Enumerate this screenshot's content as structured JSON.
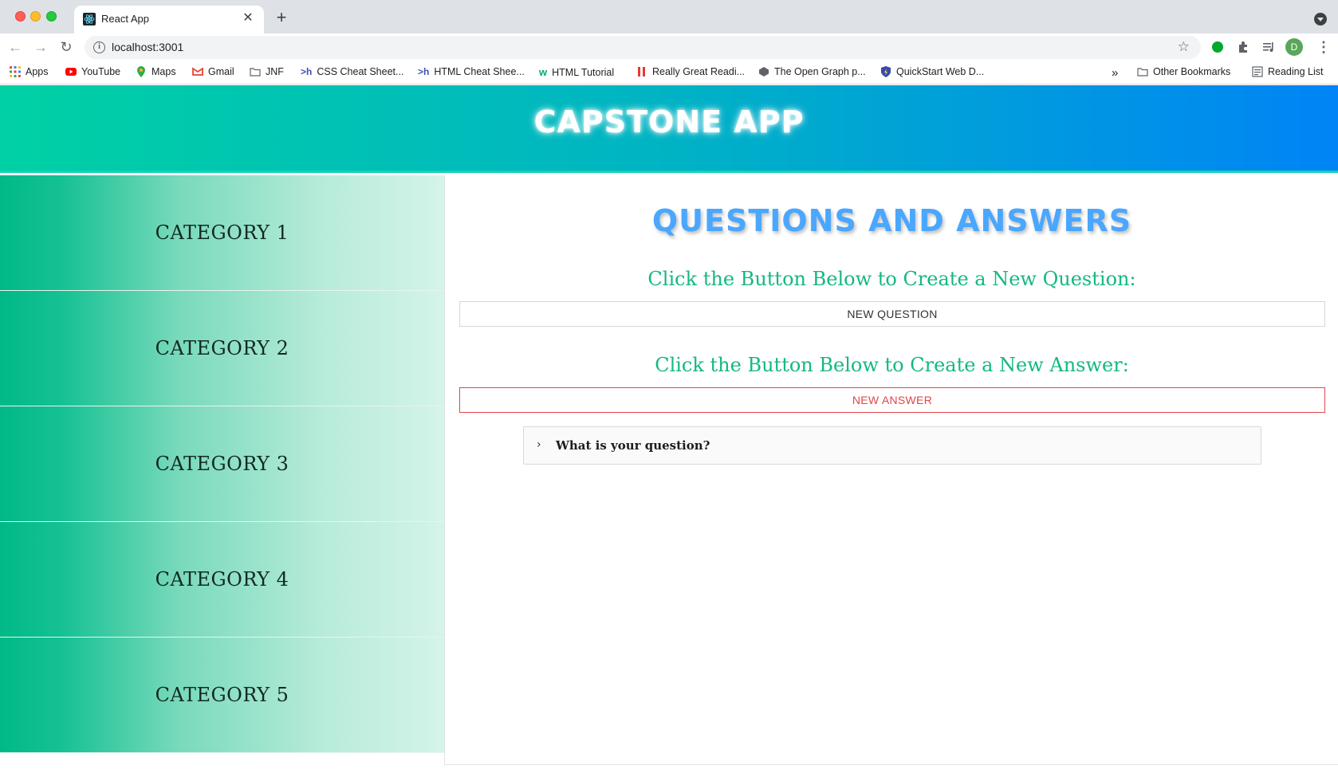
{
  "browser": {
    "tab_title": "React App",
    "tab_close": "✕",
    "new_tab": "+",
    "url": "localhost:3001",
    "avatar_letter": "D",
    "bookmarks": [
      {
        "label": "Apps",
        "icon": "apps-grid-icon",
        "color": "#ea4335"
      },
      {
        "label": "YouTube",
        "icon": "youtube-icon",
        "color": "#ff0000"
      },
      {
        "label": "Maps",
        "icon": "maps-pin-icon",
        "color": "#34a853"
      },
      {
        "label": "Gmail",
        "icon": "gmail-icon",
        "color": "#ea4335"
      },
      {
        "label": "JNF",
        "icon": "folder-icon",
        "color": "#5f6368"
      },
      {
        "label": "CSS Cheat Sheet...",
        "icon": "hackr-icon",
        "color": "#3f51b5"
      },
      {
        "label": "HTML Cheat Shee...",
        "icon": "hackr-icon",
        "color": "#3f51b5"
      },
      {
        "label": "HTML Tutorial",
        "icon": "w3schools-icon",
        "color": "#04aa6d"
      },
      {
        "label": "Really Great Readi...",
        "icon": "bars-icon",
        "color": "#e53935"
      },
      {
        "label": "The Open Graph p...",
        "icon": "opengraph-icon",
        "color": "#5f6368"
      },
      {
        "label": "QuickStart Web D...",
        "icon": "shield-icon",
        "color": "#3949ab"
      }
    ],
    "overflow": "»",
    "other_bookmarks": "Other Bookmarks",
    "reading_list": "Reading List"
  },
  "app": {
    "title": "CAPSTONE APP",
    "categories": [
      "CATEGORY 1",
      "CATEGORY 2",
      "CATEGORY 3",
      "CATEGORY 4",
      "CATEGORY 5"
    ],
    "main": {
      "heading": "QUESTIONS AND ANSWERS",
      "question_prompt": "Click the Button Below to Create a New Question:",
      "question_button": "NEW QUESTION",
      "answer_prompt": "Click the Button Below to Create a New Answer:",
      "answer_button": "NEW ANSWER",
      "accordion_label": "What is your question?"
    }
  },
  "colors": {
    "header_gradient_start": "#00d1a4",
    "header_gradient_end": "#0084f6",
    "heading_blue": "#4aa7ff",
    "prompt_green": "#14b881",
    "answer_red": "#e0464b"
  }
}
